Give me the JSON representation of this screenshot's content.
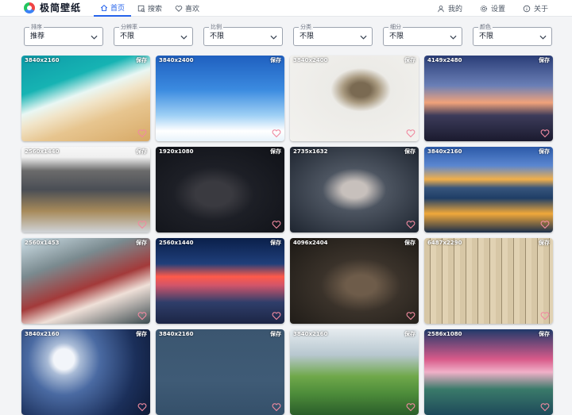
{
  "app": {
    "title": "极简壁纸"
  },
  "nav": [
    {
      "label": "首页",
      "icon": "home-icon",
      "active": true
    },
    {
      "label": "搜索",
      "icon": "image-search-icon",
      "active": false
    },
    {
      "label": "喜欢",
      "icon": "heart-icon",
      "active": false
    }
  ],
  "actions": [
    {
      "label": "我的",
      "icon": "user-icon"
    },
    {
      "label": "设置",
      "icon": "gear-icon"
    },
    {
      "label": "关于",
      "icon": "info-icon"
    }
  ],
  "filters": [
    {
      "label": "排序",
      "value": "推荐"
    },
    {
      "label": "分辨率",
      "value": "不限"
    },
    {
      "label": "比例",
      "value": "不限"
    },
    {
      "label": "分类",
      "value": "不限"
    },
    {
      "label": "细分",
      "value": "不限"
    },
    {
      "label": "颜色",
      "value": "不限"
    }
  ],
  "wallpapers": [
    {
      "resolution": "3840x2160",
      "save_label": "保存"
    },
    {
      "resolution": "3840x2400",
      "save_label": "保存"
    },
    {
      "resolution": "3840x2400",
      "save_label": "保存"
    },
    {
      "resolution": "4149x2480",
      "save_label": "保存"
    },
    {
      "resolution": "2560x1440",
      "save_label": "保存"
    },
    {
      "resolution": "1920x1080",
      "save_label": "保存"
    },
    {
      "resolution": "2735x1632",
      "save_label": "保存"
    },
    {
      "resolution": "3840x2160",
      "save_label": "保存"
    },
    {
      "resolution": "2560x1453",
      "save_label": "保存"
    },
    {
      "resolution": "2560x1440",
      "save_label": "保存"
    },
    {
      "resolution": "4096x2404",
      "save_label": "保存"
    },
    {
      "resolution": "6487x2290",
      "save_label": "保存"
    },
    {
      "resolution": "3840x2160",
      "save_label": "保存"
    },
    {
      "resolution": "3840x2160",
      "save_label": "保存"
    },
    {
      "resolution": "3840x2160",
      "save_label": "保存"
    },
    {
      "resolution": "2586x1080",
      "save_label": "保存"
    }
  ],
  "colors": {
    "accent": "#2563eb",
    "heart": "#f08aa0"
  }
}
